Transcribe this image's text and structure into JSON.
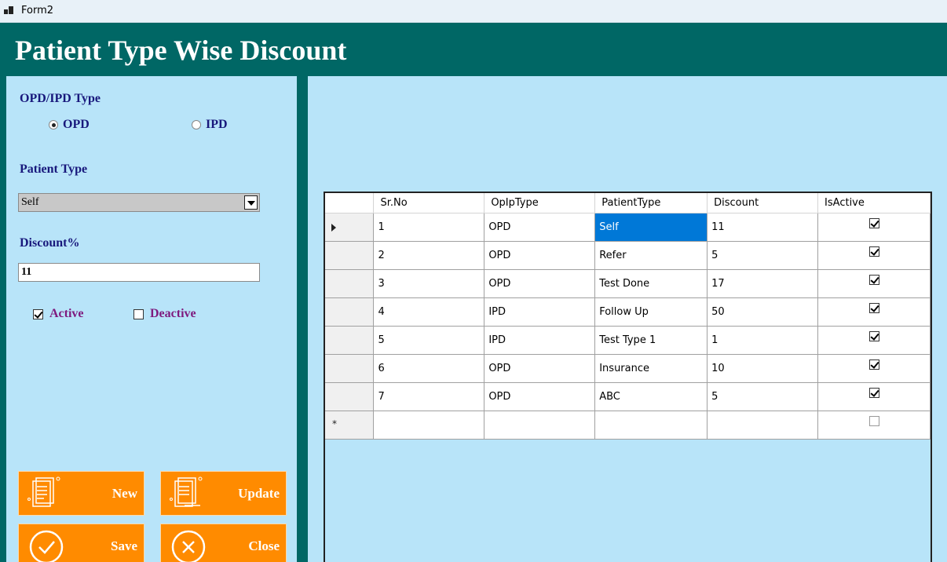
{
  "window": {
    "title": "Form2"
  },
  "header": {
    "title": "Patient Type Wise Discount"
  },
  "form": {
    "opd_ipd_label": "OPD/IPD Type",
    "radio_opd": "OPD",
    "radio_ipd": "IPD",
    "selected_type": "OPD",
    "patient_type_label": "Patient Type",
    "patient_type_value": "Self",
    "discount_label": "Discount%",
    "discount_value": "11",
    "active_label": "Active",
    "deactive_label": "Deactive",
    "active_checked": true,
    "deactive_checked": false
  },
  "buttons": {
    "new": "New",
    "update": "Update",
    "save": "Save",
    "close": "Close"
  },
  "colors": {
    "header_bg": "#006765",
    "panel_bg": "#b8e4f9",
    "button_bg": "#ff8b00",
    "label_text": "#18187c",
    "check_text": "#7e1a7e",
    "selection": "#0078d7"
  },
  "grid": {
    "columns": [
      "Sr.No",
      "OpIpType",
      "PatientType",
      "Discount",
      "IsActive"
    ],
    "rows": [
      {
        "sr": "1",
        "type": "OPD",
        "patient": "Self",
        "discount": "11",
        "active": true,
        "current": true
      },
      {
        "sr": "2",
        "type": "OPD",
        "patient": "Refer",
        "discount": "5",
        "active": true
      },
      {
        "sr": "3",
        "type": "OPD",
        "patient": "Test Done",
        "discount": "17",
        "active": true
      },
      {
        "sr": "4",
        "type": "IPD",
        "patient": "Follow Up",
        "discount": "50",
        "active": true
      },
      {
        "sr": "5",
        "type": "IPD",
        "patient": "Test Type 1",
        "discount": "1",
        "active": true
      },
      {
        "sr": "6",
        "type": "OPD",
        "patient": "Insurance",
        "discount": "10",
        "active": true
      },
      {
        "sr": "7",
        "type": "OPD",
        "patient": "ABC",
        "discount": "5",
        "active": true
      }
    ],
    "new_row_marker": "*"
  }
}
